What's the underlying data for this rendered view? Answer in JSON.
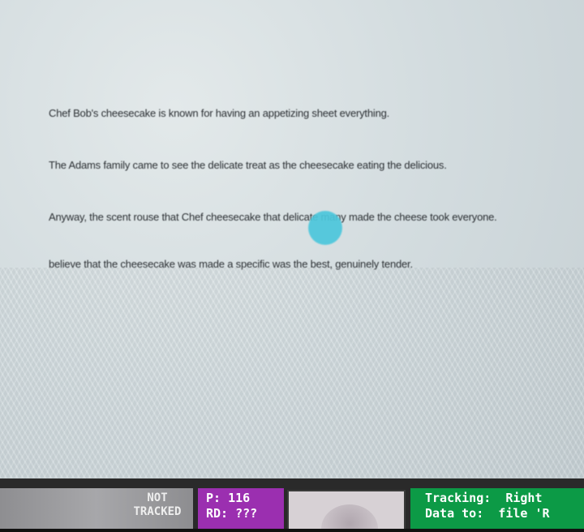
{
  "passage": {
    "lines": [
      "Chef Bob's cheesecake is known for having an appetizing sheet everything.",
      "The Adams family came to see the delicate treat as the cheesecake eating the delicious.",
      "Anyway, the scent rouse that Chef cheesecake that delicate many made the cheese took everyone.",
      "believe that the cheesecake was made a specific was the best, genuinely tender."
    ]
  },
  "status_bar": {
    "tracked_status": "NOT TRACKED",
    "counter_line_1": "P:  116",
    "counter_line_2": "RD: ???",
    "tracking_line_1": "Tracking:  Right",
    "tracking_line_2": "Data to:  file 'R"
  },
  "colors": {
    "gaze_marker": "#4cc7dc",
    "counter_panel": "#9b2fb0",
    "tracking_panel": "#0c9a46"
  }
}
